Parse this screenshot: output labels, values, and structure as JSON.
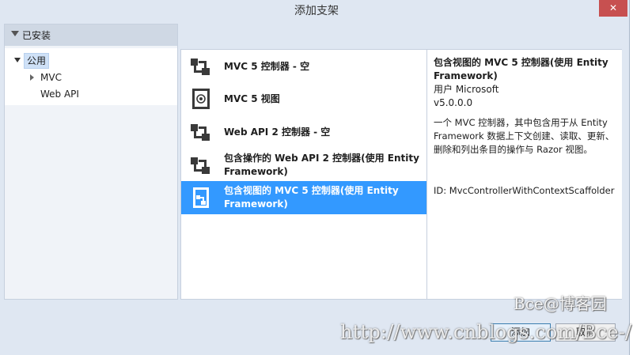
{
  "window": {
    "title": "添加支架",
    "close_glyph": "✕"
  },
  "left_panel": {
    "header": "已安装",
    "tree": [
      {
        "label": "公用",
        "expanded": true,
        "selected": true
      },
      {
        "label": "MVC",
        "expanded": false
      },
      {
        "label": "Web API"
      }
    ]
  },
  "templates": [
    {
      "label": "MVC 5 控制器 - 空",
      "icon": "controller-icon"
    },
    {
      "label": "MVC 5 视图",
      "icon": "view-icon"
    },
    {
      "label": "Web API 2 控制器 - 空",
      "icon": "controller-icon"
    },
    {
      "label": "包含操作的 Web API 2 控制器(使用 Entity Framework)",
      "icon": "controller-icon"
    },
    {
      "label": "包含视图的 MVC 5 控制器(使用 Entity Framework)",
      "icon": "controller-views-icon",
      "selected": true
    }
  ],
  "details": {
    "title": "包含视图的 MVC 5 控制器(使用 Entity Framework)",
    "author": "用户 Microsoft",
    "version": "v5.0.0.0",
    "description": "一个 MVC 控制器，其中包含用于从 Entity Framework 数据上下文创建、读取、更新、删除和列出条目的操作与 Razor 视图。",
    "id": "ID: MvcControllerWithContextScaffolder"
  },
  "buttons": {
    "add": "添加",
    "cancel": "取消"
  },
  "watermark": {
    "top": "Bce@博客园",
    "url": "http://www.cnblogs.com/Bce-/"
  },
  "colors": {
    "selection": "#3399ff",
    "chrome": "#dfe7f2",
    "close": "#c75050"
  }
}
